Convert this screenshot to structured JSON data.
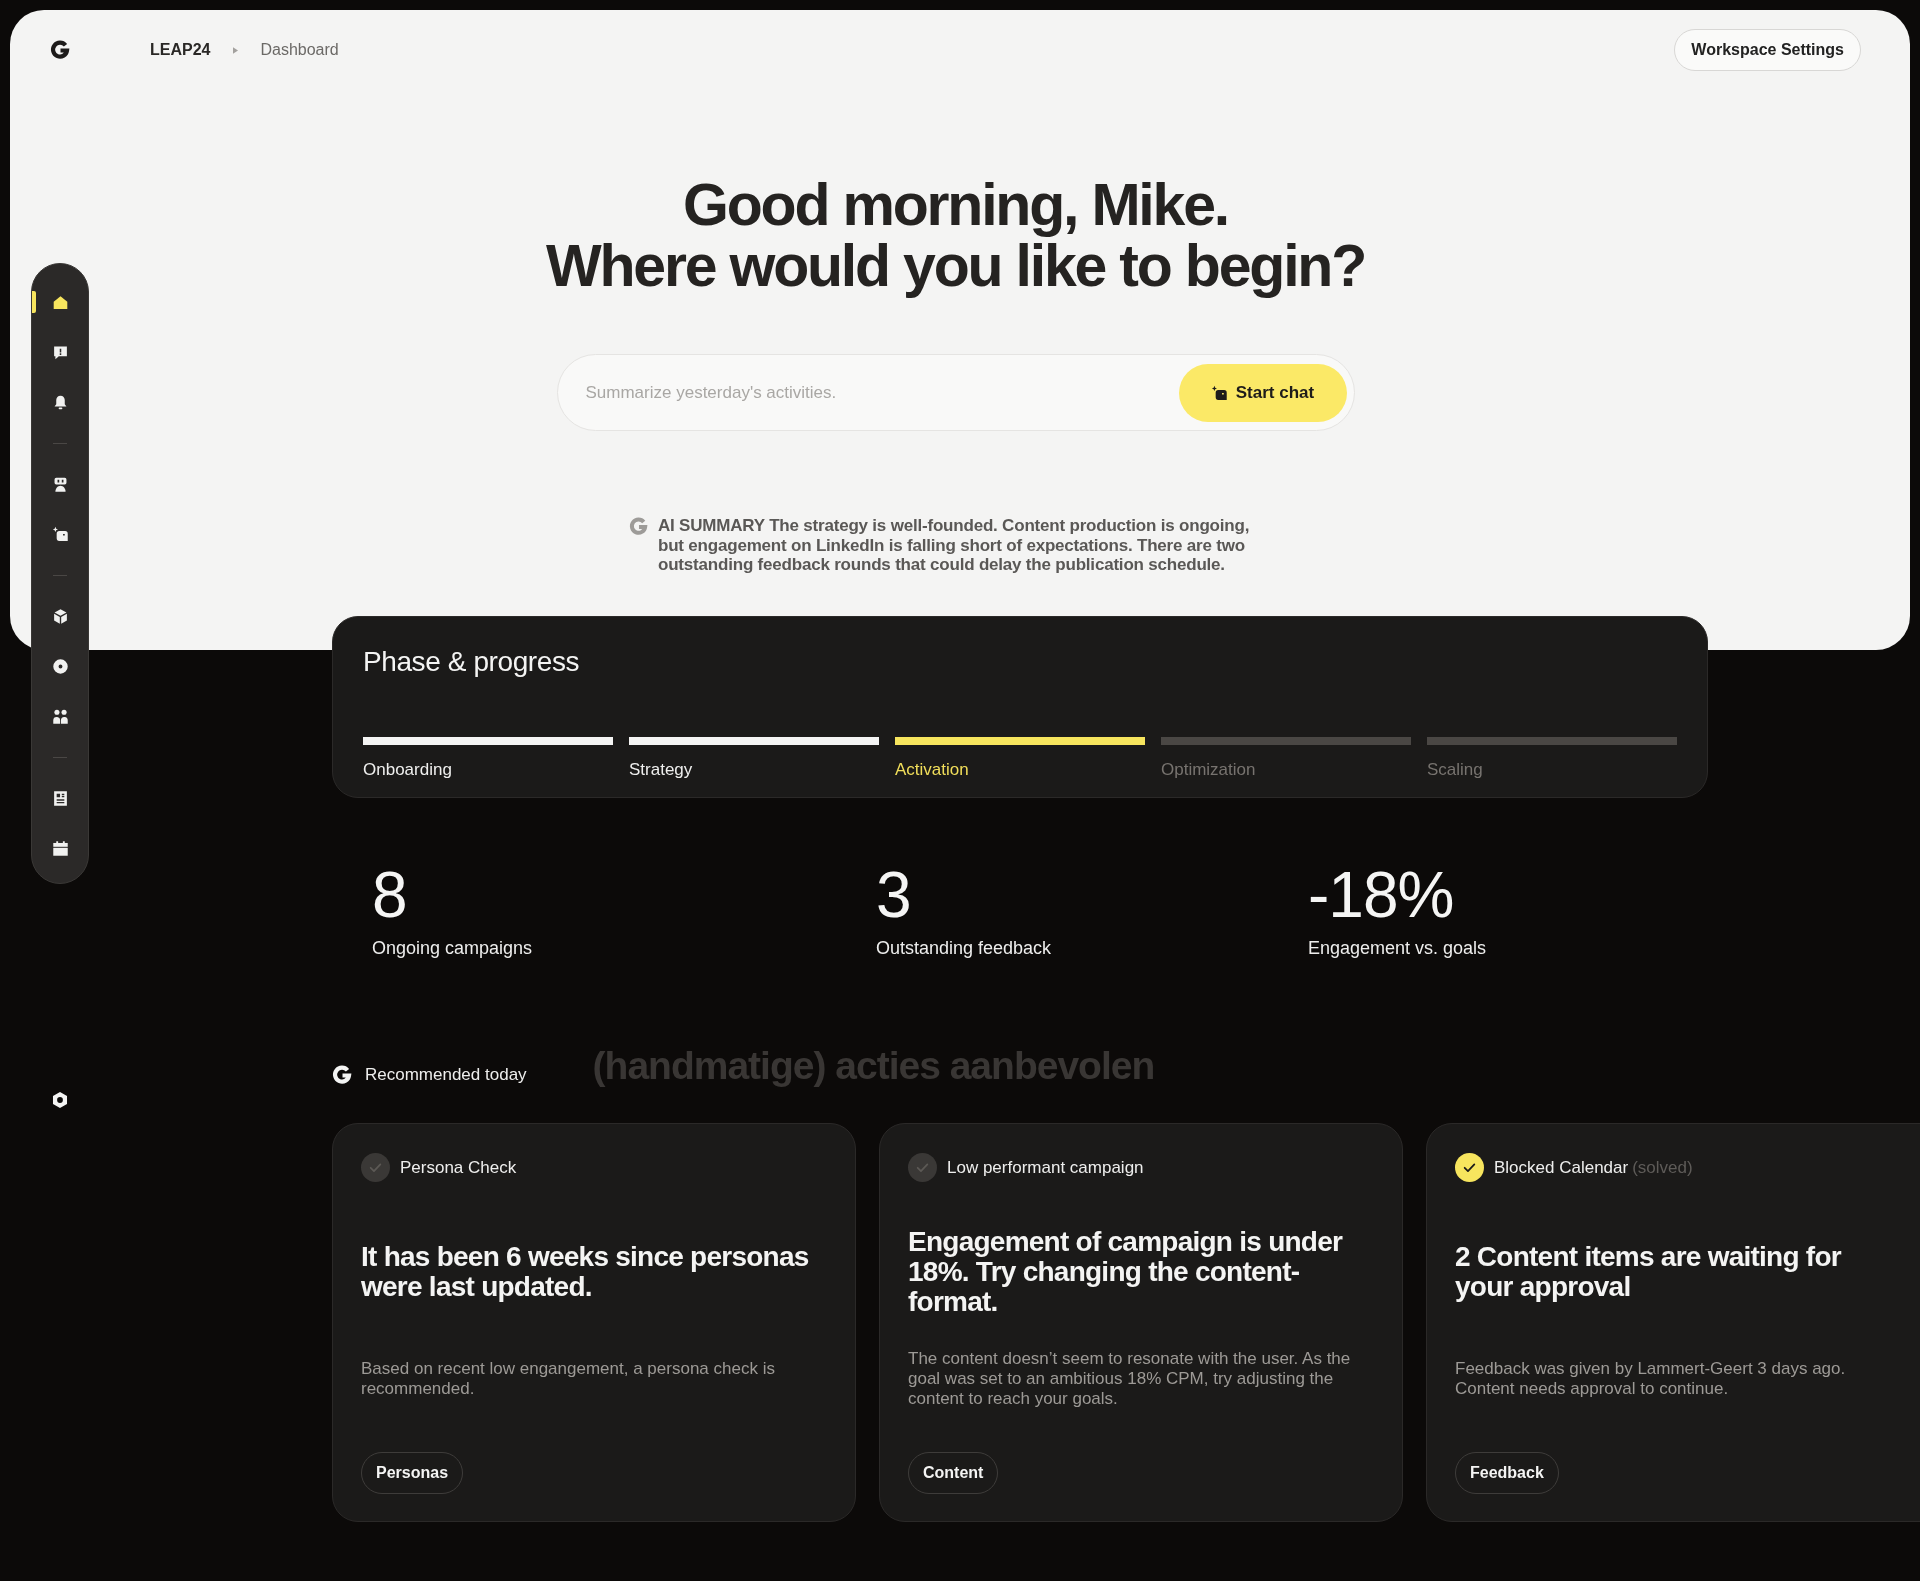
{
  "breadcrumb": [
    {
      "label": "LEAP24",
      "current": false
    },
    {
      "label": "Dashboard",
      "current": true
    }
  ],
  "header_button": "Workspace Settings",
  "sidebar": {
    "groups": [
      {
        "items": [
          {
            "selected": true
          },
          {
            "selected": false
          },
          {
            "selected": false
          }
        ]
      },
      {
        "items": [
          {
            "selected": false
          },
          {
            "selected": false
          }
        ]
      },
      {
        "items": [
          {
            "selected": false
          },
          {
            "selected": false
          },
          {
            "selected": false
          }
        ]
      },
      {
        "items": [
          {
            "selected": false
          },
          {
            "selected": false
          }
        ]
      }
    ]
  },
  "greeting": "Good morning, Mike.",
  "question": "Where would you like to begin?",
  "chat": {
    "placeholder": "Summarize yesterday's activities.",
    "button": "Start chat"
  },
  "ai_summary": "AI SUMMARY The strategy is well-founded. Content production is ongoing, but engagement on LinkedIn is falling short of expectations. There are two outstanding feedback rounds that could delay the publication schedule.",
  "phases": {
    "title": "Phase & progress",
    "steps": [
      {
        "label": "Onboarding",
        "completed": true,
        "selected": false
      },
      {
        "label": "Strategy",
        "completed": true,
        "selected": false
      },
      {
        "label": "Activation",
        "completed": false,
        "selected": true
      },
      {
        "label": "Optimization",
        "completed": false,
        "selected": false
      },
      {
        "label": "Scaling",
        "completed": false,
        "selected": false
      }
    ]
  },
  "stats": [
    {
      "value": "8",
      "label": "Ongoing campaigns"
    },
    {
      "value": "3",
      "label": "Outstanding feedback"
    },
    {
      "value": "-18%",
      "label": "Engagement vs. goals"
    }
  ],
  "recommended": {
    "title": "Recommended today",
    "note": "(handmatige) acties aanbevolen",
    "cards": [
      {
        "title": "Persona Check",
        "solved": false,
        "headline": "It has been 6 weeks since personas were last updated.",
        "description": "Based on recent low engangement, a persona check is recommended.",
        "tag": "Personas"
      },
      {
        "title": "Low performant campaign",
        "solved": false,
        "headline": "Engagement of campaign is under 18%. Try changing the content-format.",
        "description": "The content doesn’t seem to resonate with the user. As the goal was set to an ambitious 18% CPM, try adjusting the content to reach your goals.",
        "tag": "Content"
      },
      {
        "title": "Blocked Calendar",
        "status_note": "(solved)",
        "solved": true,
        "headline": "2 Content items are waiting for your approval",
        "description": "Feedback was given by Lammert-Geert 3 days ago. Content needs approval to continue.",
        "tag": "Feedback"
      }
    ]
  }
}
